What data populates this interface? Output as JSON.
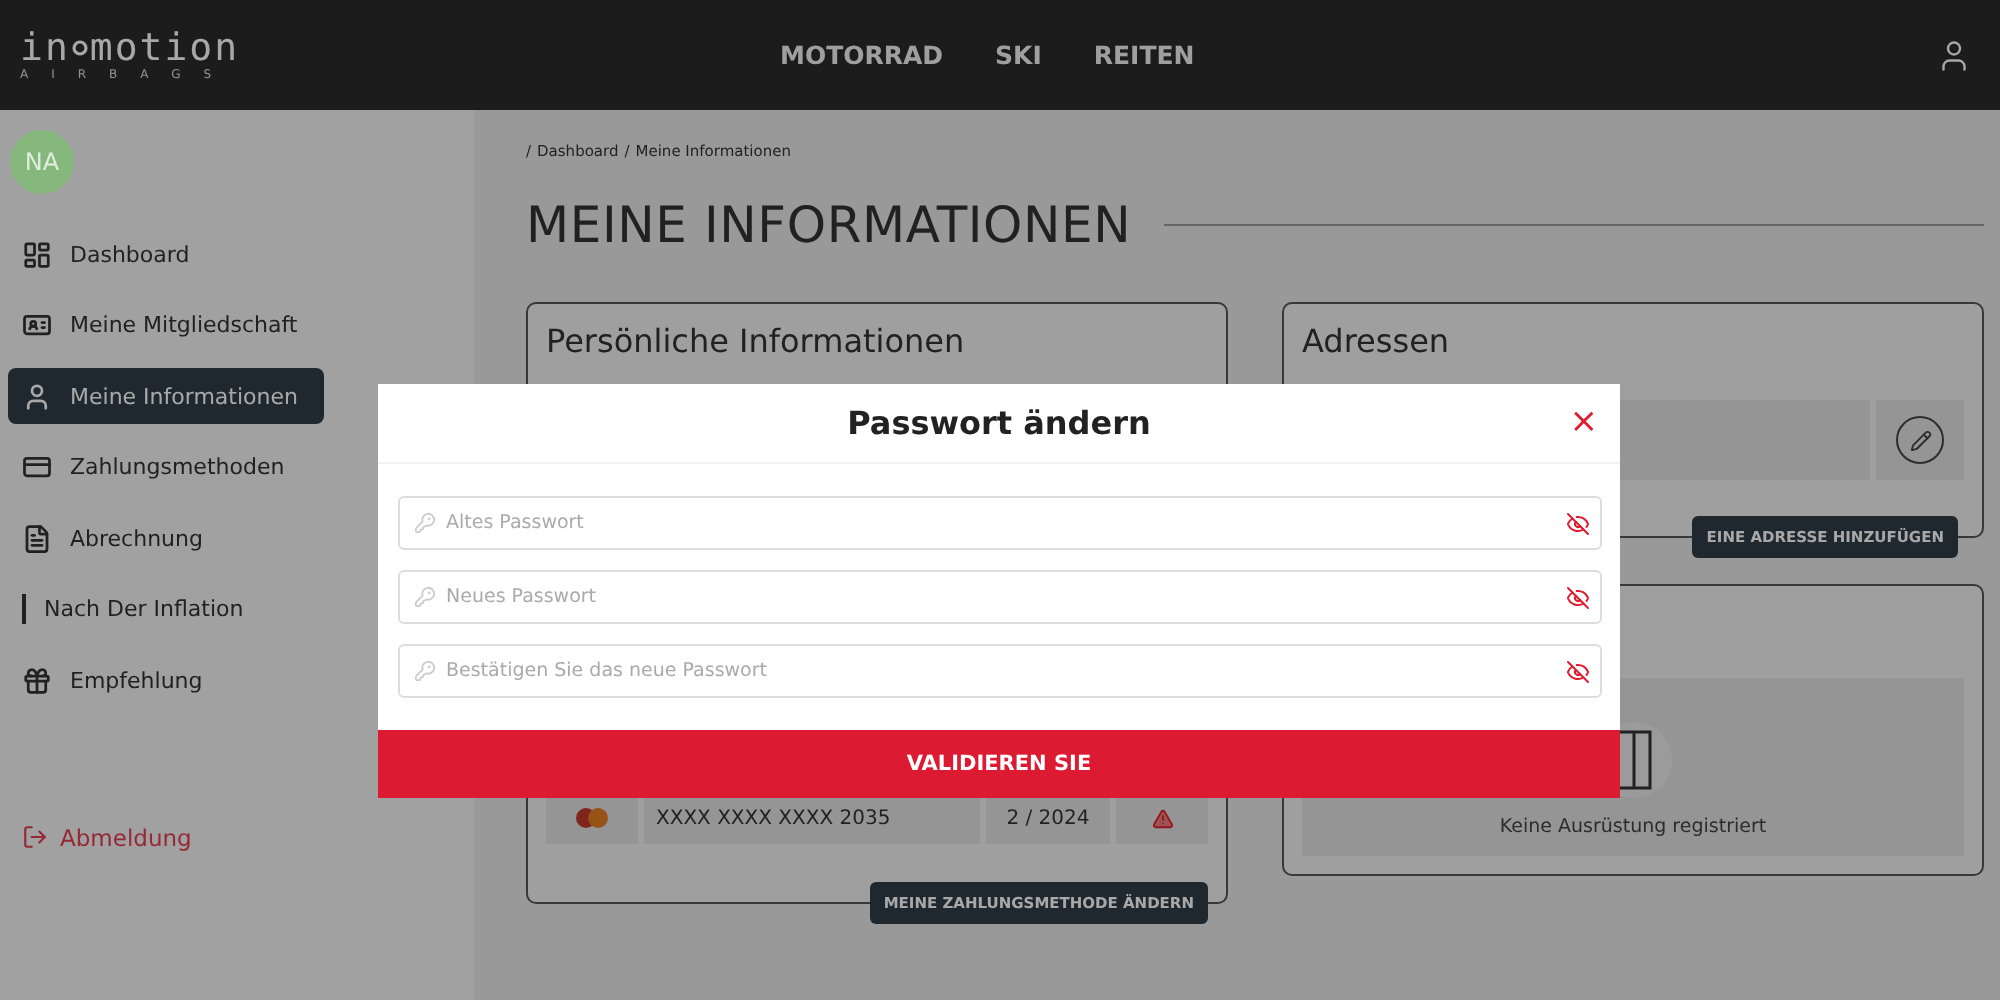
{
  "header": {
    "logo": {
      "first": "in",
      "second": "motion",
      "tagline": "AIRBAGS"
    },
    "nav": [
      {
        "label": "MOTORRAD"
      },
      {
        "label": "SKI"
      },
      {
        "label": "REITEN"
      }
    ]
  },
  "sidebar": {
    "avatar": {
      "initials": "NA",
      "color": "#86b87e"
    },
    "items": [
      {
        "label": "Dashboard",
        "selected": false
      },
      {
        "label": "Meine Mitgliedschaft",
        "selected": false
      },
      {
        "label": "Meine Informationen",
        "selected": true
      },
      {
        "label": "Zahlungsmethoden",
        "selected": false
      },
      {
        "label": "Abrechnung",
        "selected": false
      },
      {
        "label": "Nach Der Inflation",
        "selected": false
      },
      {
        "label": "Empfehlung",
        "selected": false
      }
    ],
    "logout": "Abmeldung"
  },
  "breadcrumb": [
    {
      "separator": "/",
      "label": "Dashboard"
    },
    {
      "separator": "/",
      "label": "Meine Informationen"
    }
  ],
  "page_title": "MEINE INFORMATIONEN",
  "personal_card": {
    "title": "Persönliche Informationen"
  },
  "payment_card": {
    "card_number": "XXXX XXXX XXXX 2035",
    "expiry": "2 / 2024",
    "expired": true,
    "button": "MEINE ZAHLUNGSMETHODE ÄNDERN"
  },
  "address_card": {
    "title": "Adressen",
    "button": "EINE ADRESSE HINZUFÜGEN"
  },
  "equipment_card": {
    "empty_text": "Keine Ausrüstung registriert"
  },
  "modal": {
    "title": "Passwort ändern",
    "close": "×",
    "fields": [
      {
        "placeholder": "Altes Passwort"
      },
      {
        "placeholder": "Neues Passwort"
      },
      {
        "placeholder": "Bestätigen Sie das neue Passwort"
      }
    ],
    "submit": "VALIDIEREN SIE"
  }
}
